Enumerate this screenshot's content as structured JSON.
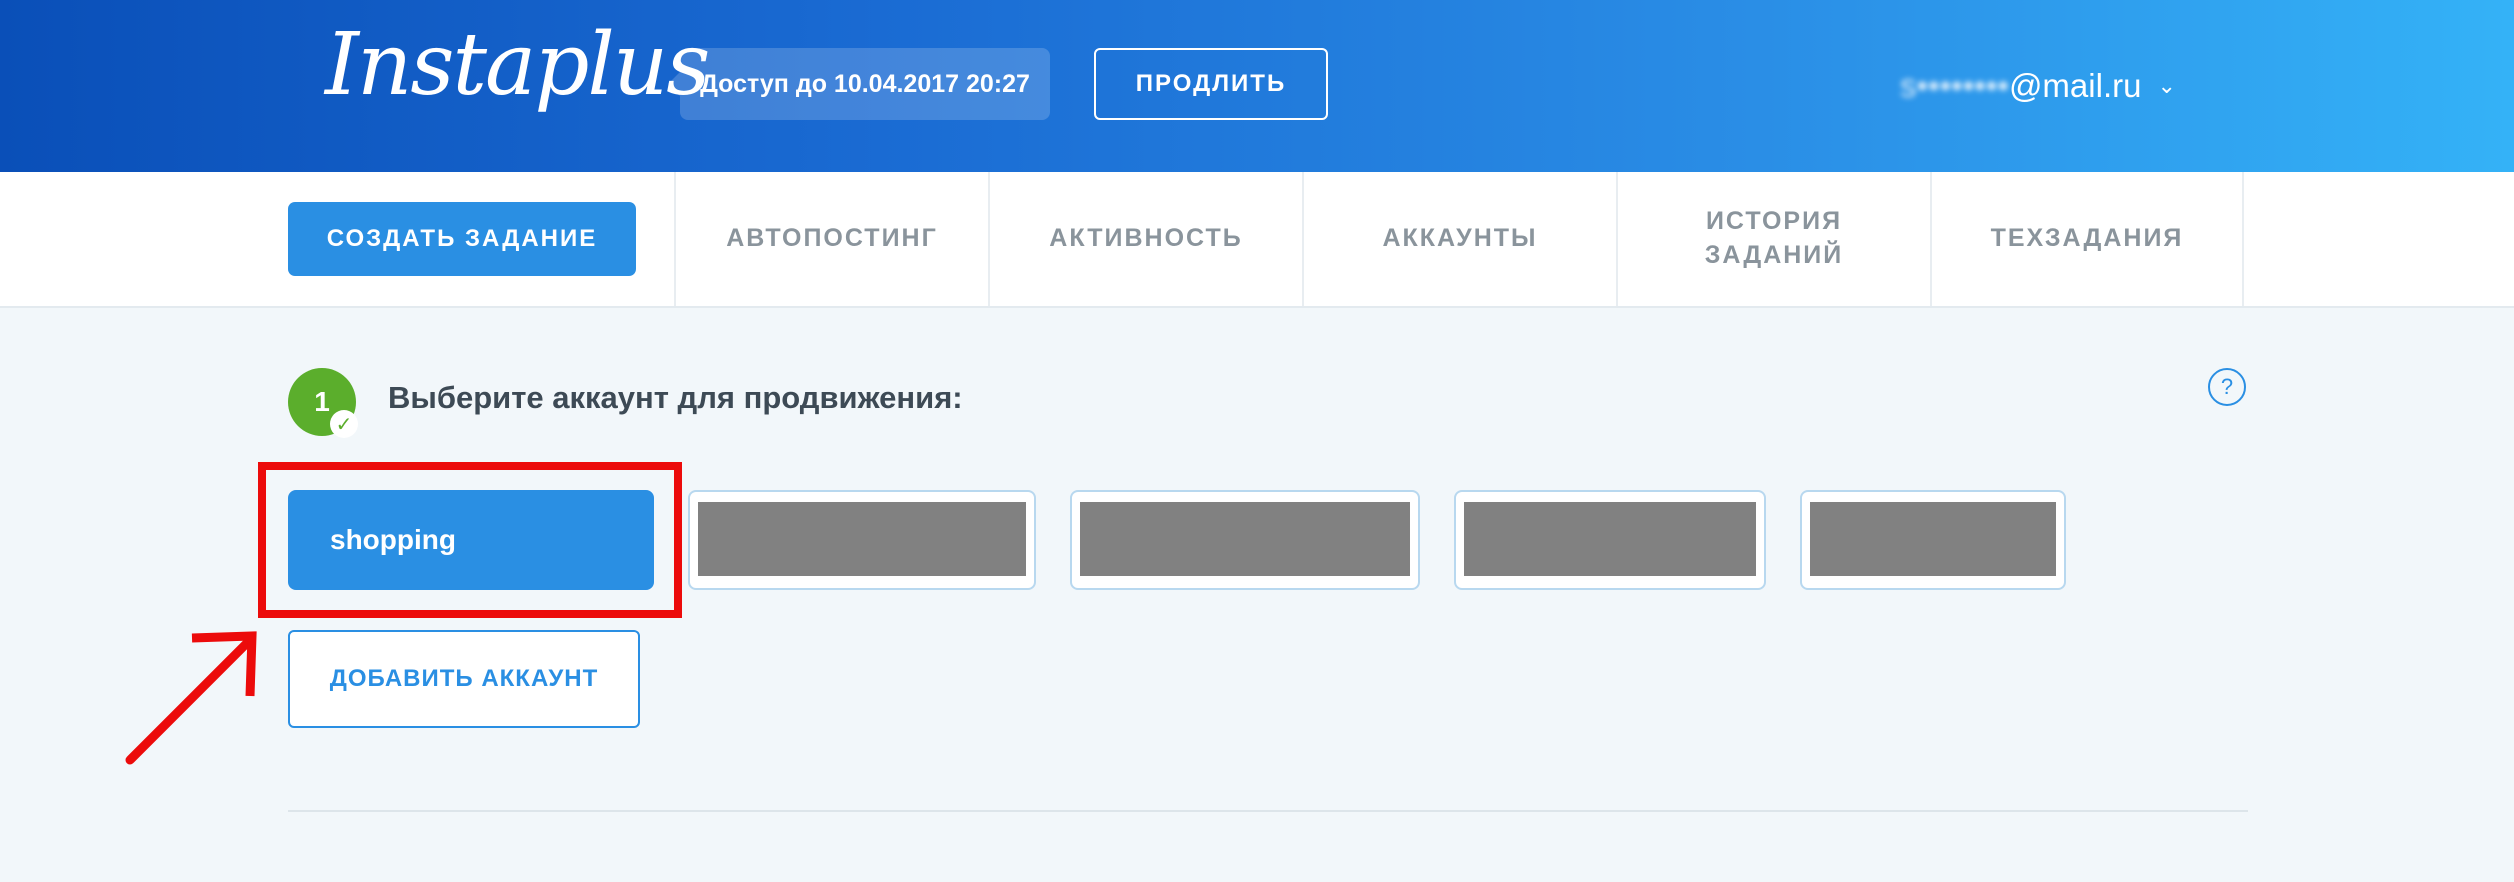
{
  "header": {
    "logo_text": "Instaplus",
    "access_text": "Доступ до 10.04.2017 20:27",
    "extend_label": "ПРОДЛИТЬ",
    "user_email_hidden": "s••••••••",
    "user_email_domain": "@mail.ru"
  },
  "nav": {
    "create_label": "СОЗДАТЬ ЗАДАНИЕ",
    "items": [
      {
        "label": "АВТОПОСТИНГ"
      },
      {
        "label": "АКТИВНОСТЬ"
      },
      {
        "label": "АККАУНТЫ"
      },
      {
        "label": "ИСТОРИЯ\nЗАДАНИЙ"
      },
      {
        "label": "ТЕХЗАДАНИЯ"
      }
    ]
  },
  "step": {
    "number": "1",
    "title": "Выберите аккаунт для продвижения:",
    "help": "?"
  },
  "accounts": {
    "selected_label": "shopping",
    "add_label": "ДОБАВИТЬ АККАУНТ"
  },
  "colors": {
    "accent": "#2a8fe3",
    "success": "#5bae2c",
    "highlight": "#ec0b0b"
  }
}
